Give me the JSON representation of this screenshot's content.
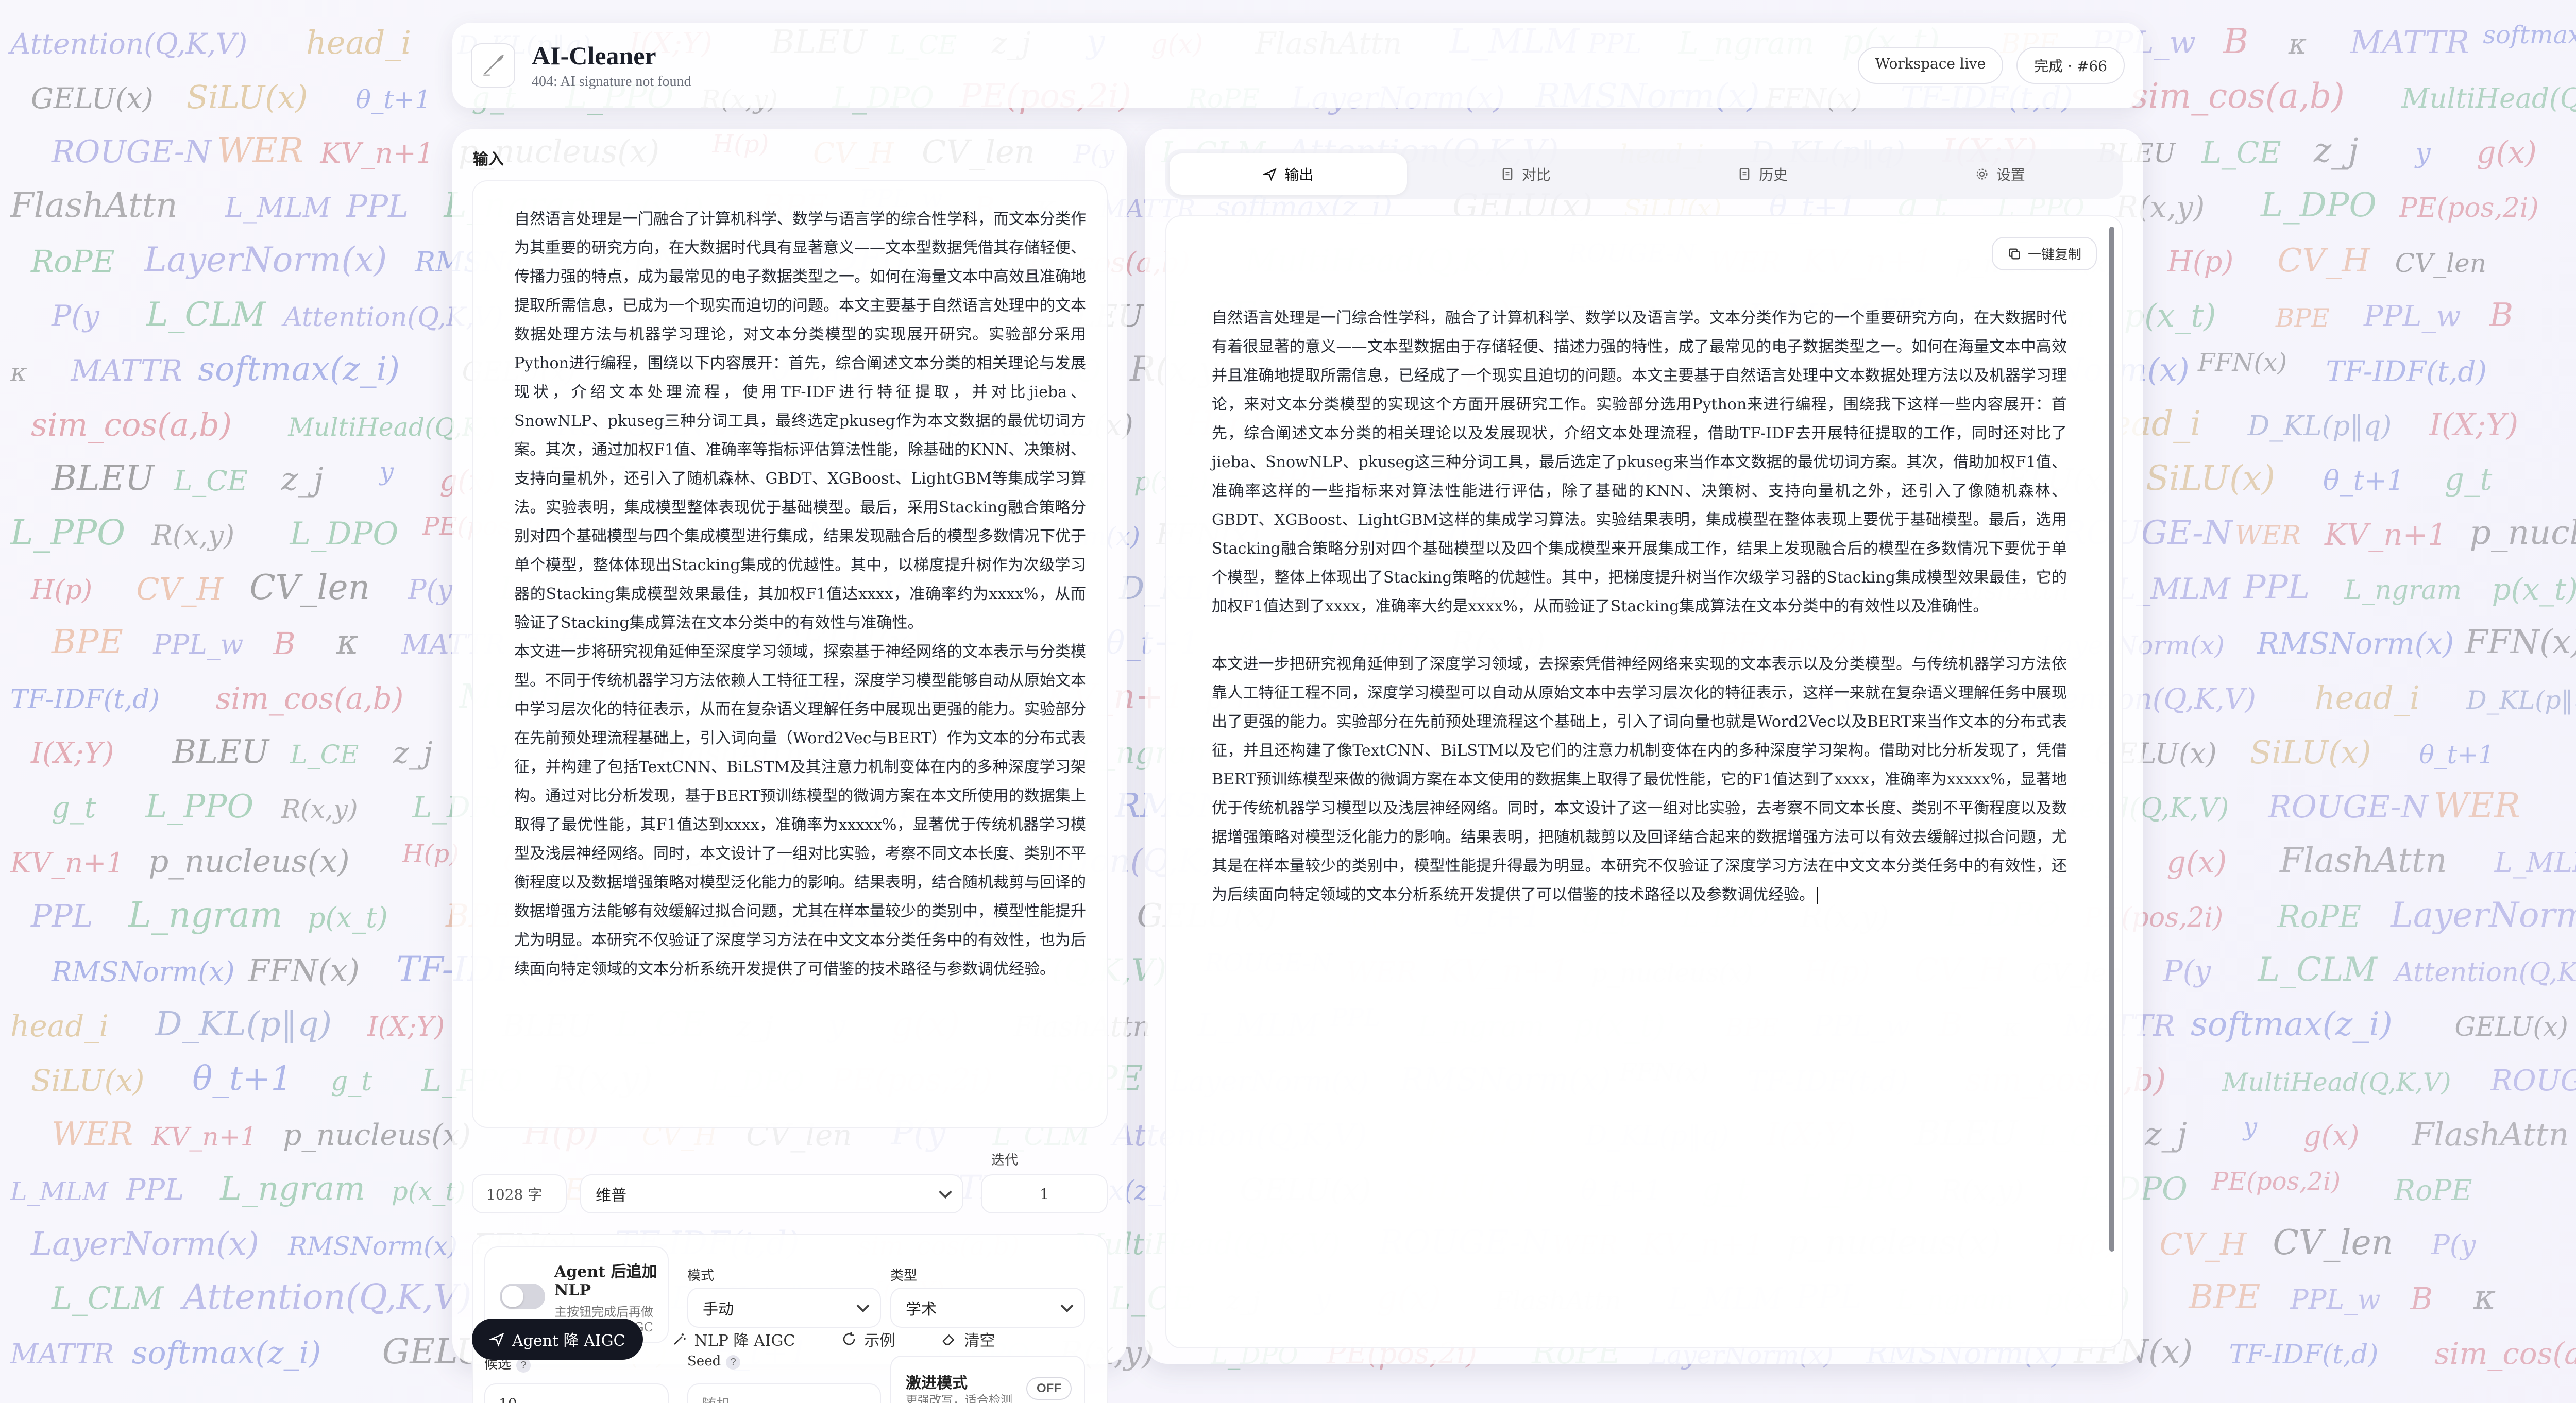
{
  "app": {
    "title": "AI-Cleaner",
    "subtitle": "404: AI signature not found",
    "status_pill": "Workspace live",
    "done_pill": "完成 · #66"
  },
  "background_formulas": [
    {
      "text": "Attention(Q,K,V)",
      "c": "#6d6fd0"
    },
    {
      "text": "head_i",
      "c": "#c79a44"
    },
    {
      "text": "D_KL(p‖q)",
      "c": "#5b6fb5"
    },
    {
      "text": "I(X;Y)",
      "c": "#c94b5b"
    },
    {
      "text": "BLEU",
      "c": "#333"
    },
    {
      "text": "L_CE",
      "c": "#49a36a"
    },
    {
      "text": "z_j",
      "c": "#444"
    },
    {
      "text": "y",
      "c": "#4a5fd0"
    },
    {
      "text": "g(x)",
      "c": "#c94b5b"
    },
    {
      "text": "FlashAttn",
      "c": "#555"
    },
    {
      "text": "L_MLM",
      "c": "#6d6fd0"
    },
    {
      "text": "PPL",
      "c": "#6d6fd0"
    },
    {
      "text": "L_ngram",
      "c": "#49a36a"
    },
    {
      "text": "p(x_t)",
      "c": "#49a36a"
    },
    {
      "text": "BPE",
      "c": "#e08a5b"
    },
    {
      "text": "PPL_w",
      "c": "#6d6fd0"
    },
    {
      "text": "B",
      "c": "#c94b5b"
    },
    {
      "text": "κ",
      "c": "#444"
    },
    {
      "text": "MATTR",
      "c": "#6d6fd0"
    },
    {
      "text": "softmax(z_i)",
      "c": "#4a5fd0"
    },
    {
      "text": "GELU(x)",
      "c": "#444"
    },
    {
      "text": "SiLU(x)",
      "c": "#c79a44"
    },
    {
      "text": "θ_t+1",
      "c": "#4a5fd0"
    },
    {
      "text": "g_t",
      "c": "#49a36a"
    },
    {
      "text": "L_PPO",
      "c": "#49a36a"
    },
    {
      "text": "R(x,y)",
      "c": "#555"
    },
    {
      "text": "L_DPO",
      "c": "#49a36a"
    },
    {
      "text": "PE(pos,2i)",
      "c": "#c94b5b"
    },
    {
      "text": "RoPE",
      "c": "#49a36a"
    },
    {
      "text": "LayerNorm(x)",
      "c": "#6d6fd0"
    },
    {
      "text": "RMSNorm(x)",
      "c": "#4a5fd0"
    },
    {
      "text": "FFN(x)",
      "c": "#444"
    },
    {
      "text": "TF-IDF(t,d)",
      "c": "#4a5fd0"
    },
    {
      "text": "sim_cos(a,b)",
      "c": "#c94b5b"
    },
    {
      "text": "MultiHead(Q,K,V)",
      "c": "#49a36a"
    },
    {
      "text": "ROUGE-N",
      "c": "#6d6fd0"
    },
    {
      "text": "WER",
      "c": "#e08a5b"
    },
    {
      "text": "KV_n+1",
      "c": "#c94b5b"
    },
    {
      "text": "p_nucleus(x)",
      "c": "#444"
    },
    {
      "text": "H(p)",
      "c": "#c94b5b"
    },
    {
      "text": "CV_H",
      "c": "#e08a5b"
    },
    {
      "text": "CV_len",
      "c": "#333"
    },
    {
      "text": "P(y",
      "c": "#6d6fd0"
    },
    {
      "text": "L_CLM",
      "c": "#49a36a"
    }
  ],
  "left": {
    "label": "输入",
    "input_paragraphs": [
      "自然语言处理是一门融合了计算机科学、数学与语言学的综合性学科，而文本分类作为其重要的研究方向，在大数据时代具有显著意义——文本型数据凭借其存储轻便、传播力强的特点，成为最常见的电子数据类型之一。如何在海量文本中高效且准确地提取所需信息，已成为一个现实而迫切的问题。本文主要基于自然语言处理中的文本数据处理方法与机器学习理论，对文本分类模型的实现展开研究。实验部分采用Python进行编程，围绕以下内容展开：首先，综合阐述文本分类的相关理论与发展现状，介绍文本处理流程，使用TF-IDF进行特征提取，并对比jieba、SnowNLP、pkuseg三种分词工具，最终选定pkuseg作为本文数据的最优切词方案。其次，通过加权F1值、准确率等指标评估算法性能，除基础的KNN、决策树、支持向量机外，还引入了随机森林、GBDT、XGBoost、LightGBM等集成学习算法。实验表明，集成模型整体表现优于基础模型。最后，采用Stacking融合策略分别对四个基础模型与四个集成模型进行集成，结果发现融合后的模型多数情况下优于单个模型，整体体现出Stacking集成的优越性。其中，以梯度提升树作为次级学习器的Stacking集成模型效果最佳，其加权F1值达xxxx，准确率约为xxxx%，从而验证了Stacking集成算法在文本分类中的有效性与准确性。",
      "本文进一步将研究视角延伸至深度学习领域，探索基于神经网络的文本表示与分类模型。不同于传统机器学习方法依赖人工特征工程，深度学习模型能够自动从原始文本中学习层次化的特征表示，从而在复杂语义理解任务中展现出更强的能力。实验部分在先前预处理流程基础上，引入词向量（Word2Vec与BERT）作为文本的分布式表征，并构建了包括TextCNN、BiLSTM及其注意力机制变体在内的多种深度学习架构。通过对比分析发现，基于BERT预训练模型的微调方案在本文所使用的数据集上取得了最优性能，其F1值达到xxxx，准确率为xxxxx%，显著优于传统机器学习模型及浅层神经网络。同时，本文设计了一组对比实验，考察不同文本长度、类别不平衡程度以及数据增强策略对模型泛化能力的影响。结果表明，结合随机裁剪与回译的数据增强方法能够有效缓解过拟合问题，尤其在样本量较少的类别中，模型性能提升尤为明显。本研究不仅验证了深度学习方法在中文文本分类任务中的有效性，也为后续面向特定领域的文本分析系统开发提供了可借鉴的技术路径与参数调优经验。"
    ],
    "char_count": "1028 字",
    "language": "维普",
    "iter_label": "迭代",
    "iter_value": "1",
    "agent_toggle_title": "Agent 后追加 NLP",
    "agent_toggle_desc": "主按钮完成后再做一次本地降 AIGC",
    "mode_label": "模式",
    "mode_value": "手动",
    "type_label": "类型",
    "type_value": "学术",
    "candidates_label": "候选",
    "candidates_value": "10",
    "seed_label": "Seed",
    "seed_value": "随机",
    "radical_title": "激进模式",
    "radical_desc": "更强改写，适合检测压力高的文本",
    "radical_state": "OFF",
    "buttons": {
      "agent": "Agent 降 AIGC",
      "nlp": "NLP 降 AIGC",
      "example": "示例",
      "clear": "清空"
    }
  },
  "right": {
    "tabs": [
      "输出",
      "对比",
      "历史",
      "设置"
    ],
    "copy_label": "一键复制",
    "output_paragraphs": [
      "自然语言处理是一门综合性学科，融合了计算机科学、数学以及语言学。文本分类作为它的一个重要研究方向，在大数据时代有着很显著的意义——文本型数据由于存储轻便、描述力强的特性，成了最常见的电子数据类型之一。如何在海量文本中高效并且准确地提取所需信息，已经成了一个现实且迫切的问题。本文主要基于自然语言处理中文本数据处理方法以及机器学习理论，来对文本分类模型的实现这个方面开展研究工作。实验部分选用Python来进行编程，围绕我下这样一些内容展开：首先，综合阐述文本分类的相关理论以及发展现状，介绍文本处理流程，借助TF-IDF去开展特征提取的工作，同时还对比了jieba、SnowNLP、pkuseg这三种分词工具，最后选定了pkuseg来当作本文数据的最优切词方案。其次，借助加权F1值、准确率这样的一些指标来对算法性能进行评估，除了基础的KNN、决策树、支持向量机之外，还引入了像随机森林、GBDT、XGBoost、LightGBM这样的集成学习算法。实验结果表明，集成模型在整体表现上要优于基础模型。最后，选用Stacking融合策略分别对四个基础模型以及四个集成模型来开展集成工作，结果上发现融合后的模型在多数情况下要优于单个模型，整体上体现出了Stacking策略的优越性。其中，把梯度提升树当作次级学习器的Stacking集成模型效果最佳，它的加权F1值达到了xxxx，准确率大约是xxxx%，从而验证了Stacking集成算法在文本分类中的有效性以及准确性。",
      "本文进一步把研究视角延伸到了深度学习领域，去探索凭借神经网络来实现的文本表示以及分类模型。与传统机器学习方法依靠人工特征工程不同，深度学习模型可以自动从原始文本中去学习层次化的特征表示，这样一来就在复杂语义理解任务中展现出了更强的能力。实验部分在先前预处理流程这个基础上，引入了词向量也就是Word2Vec以及BERT来当作文本的分布式表征，并且还构建了像TextCNN、BiLSTM以及它们的注意力机制变体在内的多种深度学习架构。借助对比分析发现了，凭借BERT预训练模型来做的微调方案在本文使用的数据集上取得了最优性能，它的F1值达到了xxxx，准确率为xxxxx%，显著地优于传统机器学习模型以及浅层神经网络。同时，本文设计了这一组对比实验，去考察不同文本长度、类别不平衡程度以及数据增强策略对模型泛化能力的影响。结果表明，把随机裁剪以及回译结合起来的数据增强方法可以有效去缓解过拟合问题，尤其是在样本量较少的类别中，模型性能提升得最为明显。本研究不仅验证了深度学习方法在中文文本分类任务中的有效性，还为后续面向特定领域的文本分析系统开发提供了可以借鉴的技术路径以及参数调优经验。"
    ]
  }
}
